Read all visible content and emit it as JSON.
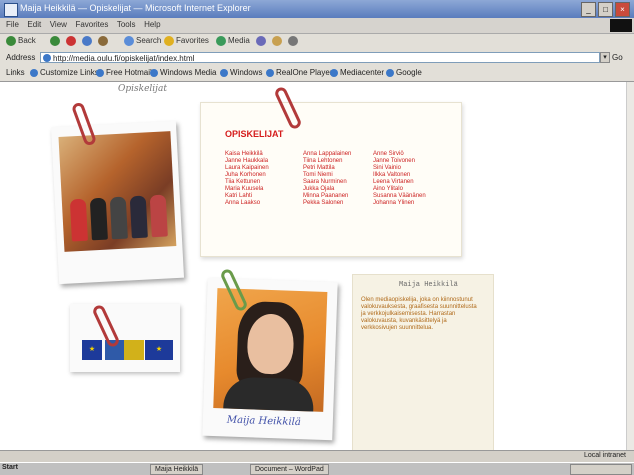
{
  "window": {
    "title": "Maija Heikkilä — Opiskelijat — Microsoft Internet Explorer"
  },
  "menu": [
    "File",
    "Edit",
    "View",
    "Favorites",
    "Tools",
    "Help"
  ],
  "toolbar": {
    "back": "Back",
    "search": "Search",
    "favorites": "Favorites",
    "media": "Media"
  },
  "address": {
    "label": "Address",
    "value": "http://media.oulu.fi/opiskelijat/index.html",
    "go": "Go"
  },
  "links": {
    "label": "Links",
    "items": [
      "Customize Links",
      "Free Hotmail",
      "Windows Media",
      "Windows",
      "RealOne Player",
      "Mediacenter",
      "Google"
    ]
  },
  "page": {
    "handnote": "Opiskelijat",
    "list_heading": "OPISKELIJAT",
    "col1": [
      "Kaisa Heikkilä",
      "Janne Haukkala",
      "Laura Kaipainen",
      "Juha Korhonen",
      "Tiia Kettunen",
      "Maria Kuusela",
      "Katri Lahti",
      "Anna Laakso"
    ],
    "col2": [
      "Anna Lappalainen",
      "Tiina Lehtonen",
      "Petri Mattila",
      "Tomi Niemi",
      "Saara Nurminen",
      "Jukka Ojala",
      "Minna Paananen",
      "Pekka Salonen"
    ],
    "col3": [
      "Anne Sirviö",
      "Janne Toivonen",
      "Sini Vainio",
      "Ilkka Valtonen",
      "Leena Virtanen",
      "Aino Ylitalo",
      "Susanna Väänänen",
      "Johanna Ylinen"
    ],
    "bio_title": "Maija Heikkilä",
    "bio_text": "Olen mediaopiskelija, joka on kiinnostunut valokuvauksesta, graafisesta suunnittelusta ja verkkojulkaisemisesta. Harrastan valokuvausta, kuvankäsittelyä ja verkkosivujen suunnittelua.",
    "signature": "Maija Heikkilä",
    "flag_stars": "★"
  },
  "status": {
    "zone": "Local intranet"
  },
  "taskbar": {
    "start": "Start",
    "tasks": [
      "Maija Heikkilä",
      "Document – WordPad"
    ]
  },
  "colors": {
    "accent_red": "#d51c1c",
    "titlebar": "#5a7cbd"
  }
}
